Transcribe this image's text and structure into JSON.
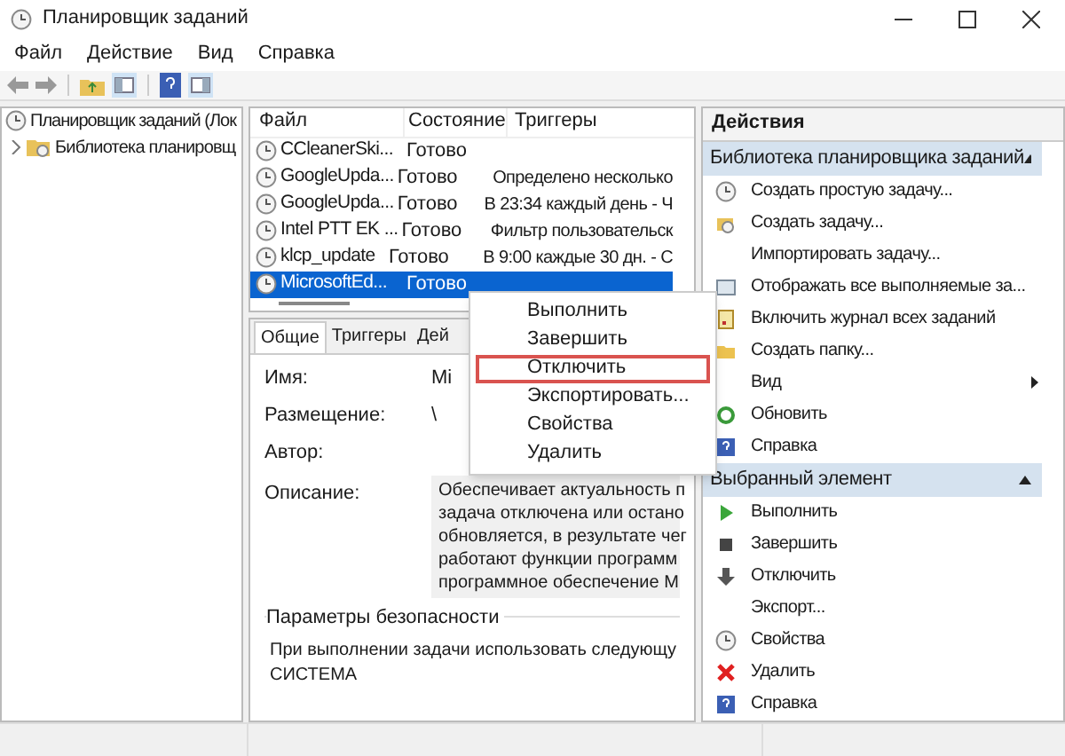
{
  "window": {
    "title": "Планировщик заданий"
  },
  "menu": [
    "Файл",
    "Действие",
    "Вид",
    "Справка"
  ],
  "tree": [
    {
      "label": "Планировщик заданий (Лок",
      "children": [
        {
          "label": "Библиотека планировщ",
          "expanded": false,
          "selected": false
        }
      ]
    }
  ],
  "tasks": {
    "columns": [
      "Файл",
      "Состояние",
      "Триггеры"
    ],
    "rows": [
      {
        "name": "CCleanerSki...",
        "status": "Готово",
        "selected": false
      },
      {
        "name": "GoogleUpda...",
        "status": "Готово",
        "trigger": "Определено несколько",
        "selected": false
      },
      {
        "name": "GoogleUpda...",
        "status": "Готово",
        "trigger": "В 23:34 каждый день - Ч",
        "selected": false
      },
      {
        "name": "Intel PTT EK ...",
        "status": "Готово",
        "trigger": "Фильтр пользовательск",
        "selected": false
      },
      {
        "name": "klcp_update",
        "status": "Готово",
        "trigger": "В 9:00 каждые 30 дн. - С",
        "selected": false
      },
      {
        "name": "MicrosoftEd...",
        "status": "Готово",
        "selected": true
      }
    ]
  },
  "details": {
    "tabs": [
      {
        "label": "Общие",
        "selected": true
      },
      {
        "label": "Триггеры",
        "selected": false
      },
      {
        "label": "Дей",
        "selected": false
      }
    ],
    "fields": [
      {
        "label": "Имя:",
        "value": "Mi"
      },
      {
        "label": "Размещение:",
        "value": "\\"
      },
      {
        "label": "Автор:"
      }
    ],
    "description": {
      "label": "Описание:",
      "lines": [
        "Обеспечивает актуальность п",
        "задача отключена или остано",
        "обновляется, в результате чег",
        "работают функции программ",
        "программное обеспечение М"
      ]
    },
    "security": {
      "title": "Параметры безопасности",
      "lines": [
        "При выполнении задачи использовать следующу",
        "СИСТЕМА"
      ]
    }
  },
  "context_menu": [
    {
      "label": "Выполнить",
      "highlighted": false
    },
    {
      "label": "Завершить",
      "highlighted": false
    },
    {
      "label": "Отключить",
      "highlighted": true
    },
    {
      "label": "Экспортировать...",
      "highlighted": false
    },
    {
      "label": "Свойства",
      "highlighted": false
    },
    {
      "label": "Удалить",
      "highlighted": false
    }
  ],
  "actions": {
    "title": "Действия",
    "sections": [
      {
        "title": "Библиотека планировщика заданий",
        "expanded": true,
        "items": [
          {
            "label": "Создать простую задачу...",
            "submenu": false
          },
          {
            "label": "Создать задачу...",
            "submenu": false
          },
          {
            "label": "Импортировать задачу...",
            "submenu": false
          },
          {
            "label": "Отображать все выполняемые за...",
            "submenu": false
          },
          {
            "label": "Включить журнал всех заданий",
            "submenu": false
          },
          {
            "label": "Создать папку...",
            "submenu": false
          },
          {
            "label": "Вид",
            "submenu": true
          },
          {
            "label": "Обновить",
            "submenu": false
          },
          {
            "label": "Справка",
            "submenu": false
          }
        ]
      },
      {
        "title": "Выбранный элемент",
        "expanded": true,
        "items": [
          {
            "label": "Выполнить",
            "submenu": false
          },
          {
            "label": "Завершить",
            "submenu": false
          },
          {
            "label": "Отключить",
            "submenu": false
          },
          {
            "label": "Экспорт...",
            "submenu": false
          },
          {
            "label": "Свойства",
            "submenu": false
          },
          {
            "label": "Удалить",
            "submenu": false
          },
          {
            "label": "Справка",
            "submenu": false
          }
        ]
      }
    ]
  }
}
